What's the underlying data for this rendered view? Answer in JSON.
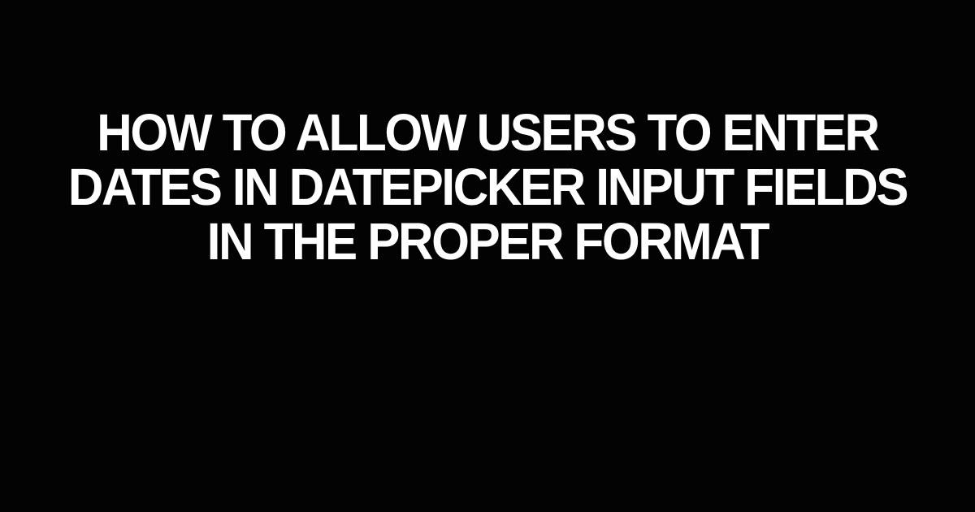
{
  "title": "HOW TO ALLOW USERS TO ENTER DATES IN DATEPICKER INPUT FIELDS IN THE PROPER FORMAT"
}
